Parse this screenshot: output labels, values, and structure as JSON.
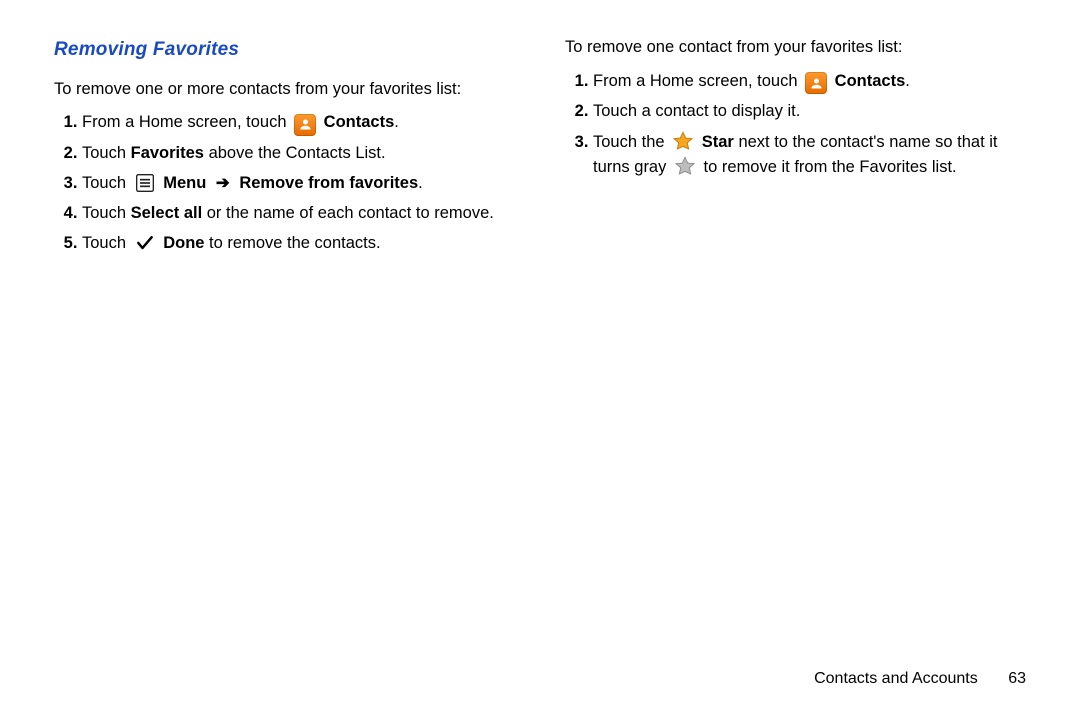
{
  "left": {
    "heading": "Removing Favorites",
    "intro": "To remove one or more contacts from your favorites list:",
    "s1_a": "From a Home screen, touch ",
    "s1_b": "Contacts",
    "s1_c": ".",
    "s2_a": "Touch ",
    "s2_b": "Favorites",
    "s2_c": " above the Contacts List.",
    "s3_a": "Touch ",
    "s3_b": "Menu",
    "s3_arrow": "➔",
    "s3_c": "Remove from favorites",
    "s3_d": ".",
    "s4_a": "Touch ",
    "s4_b": "Select all",
    "s4_c": " or the name of each contact to remove.",
    "s5_a": "Touch ",
    "s5_b": "Done",
    "s5_c": " to remove the contacts."
  },
  "right": {
    "intro": "To remove one contact from your favorites list:",
    "s1_a": "From a Home screen, touch ",
    "s1_b": "Contacts",
    "s1_c": ".",
    "s2": "Touch a contact to display it.",
    "s3_a": "Touch the ",
    "s3_b": "Star",
    "s3_c": " next to the contact's name so that it turns gray ",
    "s3_d": " to remove it from the Favorites list."
  },
  "footer": {
    "section": "Contacts and Accounts",
    "page": "63"
  }
}
